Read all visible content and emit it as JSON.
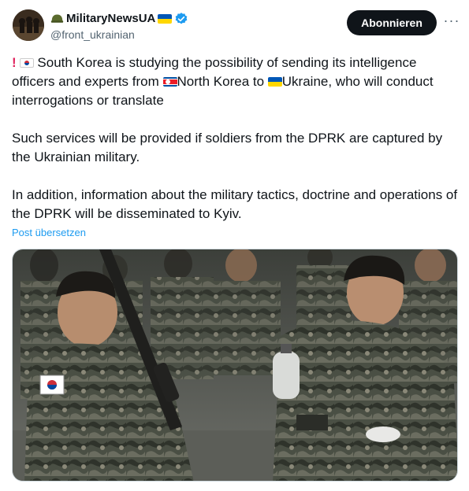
{
  "author": {
    "display_name": "MilitaryNewsUA",
    "handle": "@front_ukrainian",
    "verified": true,
    "avatar": "avatar-image"
  },
  "actions": {
    "subscribe_label": "Abonnieren",
    "more_label": "···"
  },
  "post": {
    "line1_part1": "South Korea is studying the possibility of sending its intelligence officers and experts from ",
    "line1_part2": "North Korea to ",
    "line1_part3": "Ukraine, who will conduct interrogations or translate",
    "paragraph2": "Such services will be provided if soldiers from the DPRK are captured by the Ukrainian military.",
    "paragraph3": "In addition, information about the military tactics, doctrine and operations of the DPRK will be disseminated to Kyiv.",
    "translate_link": "Post übersetzen"
  },
  "icons": {
    "helmet": "helmet-emoji-icon",
    "flag_ukraine": "ukraine-flag-icon",
    "flag_south_korea": "south-korea-flag-icon",
    "flag_north_korea": "north-korea-flag-icon",
    "verified": "verified-badge-icon",
    "exclamation": "exclamation-icon"
  },
  "media": {
    "description": "photo-soldiers"
  },
  "colors": {
    "accent": "#1d9bf0",
    "button_bg": "#0f1419",
    "verified": "#1d9bf0",
    "exclamation": "#e0245e"
  }
}
